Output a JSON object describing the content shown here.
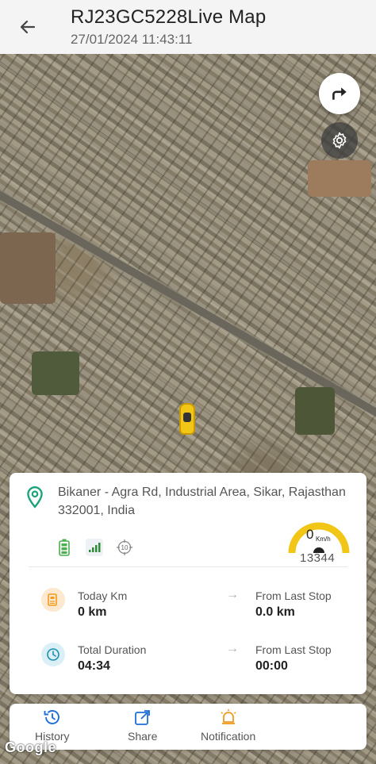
{
  "header": {
    "title": "RJ23GC5228Live Map",
    "datetime": "27/01/2024 11:43:11"
  },
  "map": {
    "attribution": "Google"
  },
  "card": {
    "address": "Bikaner - Agra Rd, Industrial Area, Sikar, Rajasthan 332001, India",
    "gps_number": "10",
    "speed": "0",
    "speed_unit": "Km/h",
    "odometer": "13344",
    "stats": {
      "today_km_label": "Today Km",
      "today_km_value": "0 km",
      "from_last_stop_distance_label": "From Last Stop",
      "from_last_stop_distance_value": "0.0 km",
      "total_duration_label": "Total Duration",
      "total_duration_value": "04:34",
      "from_last_stop_time_label": "From Last Stop",
      "from_last_stop_time_value": "00:00"
    }
  },
  "bottom_nav": {
    "history": "History",
    "share": "Share",
    "notification": "Notification"
  },
  "colors": {
    "accent_blue": "#1e6fd9",
    "location_green": "#1aa37a",
    "gauge_yellow": "#f2c616",
    "stat_orange": "#f29a1e",
    "stat_teal": "#1b8fb0"
  }
}
